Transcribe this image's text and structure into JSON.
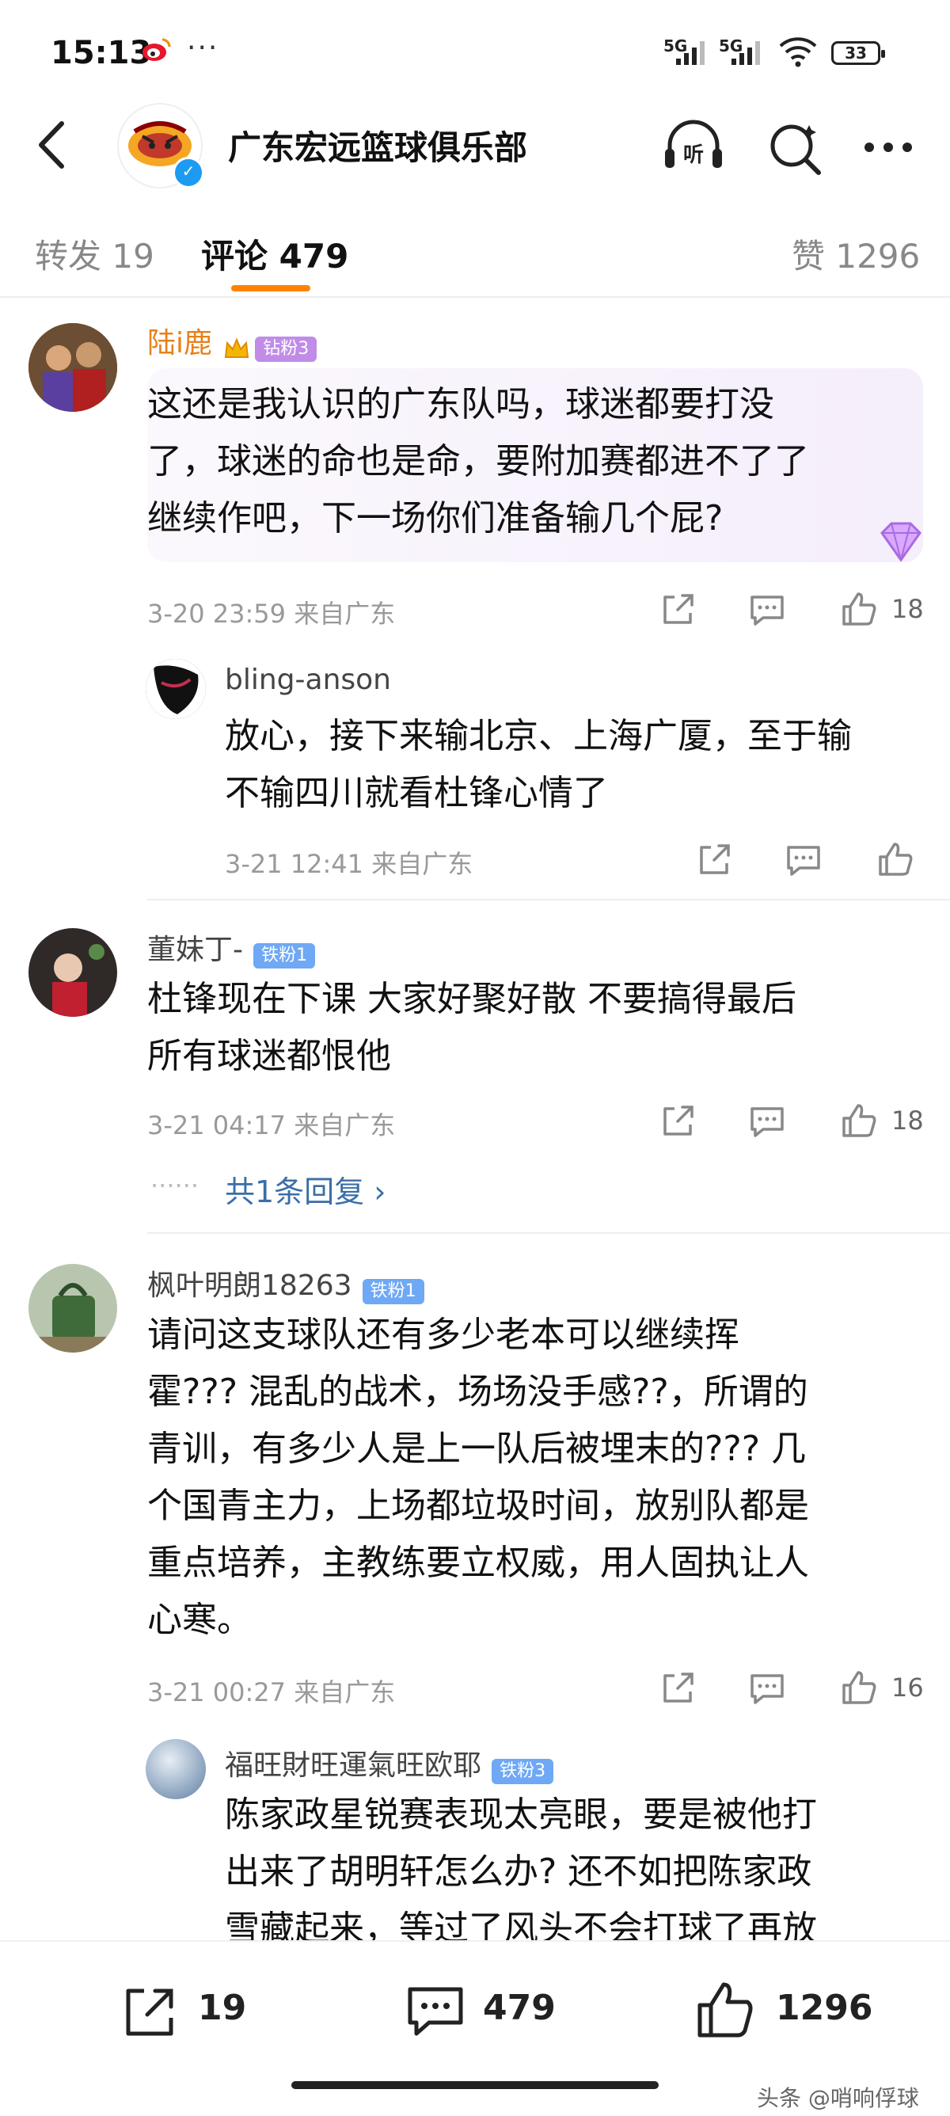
{
  "status_bar": {
    "time": "15:13",
    "more": "···",
    "sig1": "5G",
    "sig2": "5G",
    "battery": "33"
  },
  "header": {
    "title": "广东宏远篮球俱乐部"
  },
  "tabs": {
    "repost": "转发 19",
    "comments": "评论 479",
    "likes": "赞 1296"
  },
  "comments": [
    {
      "user": "陆i鹿",
      "badge": "钻粉3",
      "text_lines": [
        "这还是我认识的广东队吗，球迷都要打没",
        "了，球迷的命也是命，要附加赛都进不了了",
        "继续作吧，下一场你们准备输几个屁?"
      ],
      "meta": "3-20 23:59 来自广东",
      "likes": "18",
      "reply": {
        "user": "bling-anson",
        "text_lines": [
          "放心，接下来输北京、上海广厦，至于输",
          "不输四川就看杜锋心情了"
        ],
        "meta": "3-21 12:41 来自广东"
      }
    },
    {
      "user": "董妹丁-",
      "badge": "铁粉1",
      "text_lines": [
        "杜锋现在下课 大家好聚好散 不要搞得最后",
        "所有球迷都恨他"
      ],
      "meta": "3-21 04:17 来自广东",
      "likes": "18",
      "more_replies_prefix": "······",
      "more_replies": "共1条回复 ›"
    },
    {
      "user": "枫叶明朗18263",
      "badge": "铁粉1",
      "text_lines": [
        "请问这支球队还有多少老本可以继续挥",
        "霍??? 混乱的战术，场场没手感??，所谓的",
        "青训，有多少人是上一队后被埋末的??? 几",
        "个国青主力，上场都垃圾时间，放别队都是",
        "重点培养，主教练要立权威，用人固执让人",
        "心寒。"
      ],
      "meta": "3-21 00:27 来自广东",
      "likes": "16",
      "reply": {
        "user": "福旺財旺運氣旺欧耶",
        "badge": "铁粉3",
        "text_lines": [
          "陈家政星锐赛表现太亮眼，要是被他打",
          "出来了胡明轩怎么办? 还不如把陈家政",
          "雪藏起来，等过了风头不会打球了再放"
        ]
      }
    }
  ],
  "bottom_bar": {
    "reposts": "19",
    "comments": "479",
    "likes": "1296"
  },
  "watermark": "头条 @哨响俘球",
  "colors": {
    "accent": "#ff8200",
    "link": "#3b6ea8",
    "fan_badge_blue": "#6fa8f5",
    "fan_badge_purple": "#c08ce8"
  }
}
